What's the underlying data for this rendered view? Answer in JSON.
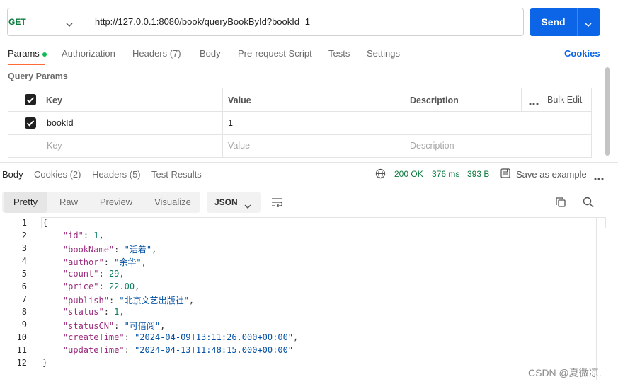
{
  "request": {
    "method": "GET",
    "url": "http://127.0.0.1:8080/book/queryBookById?bookId=1",
    "send_label": "Send",
    "method_color": "#0b7a3e",
    "send_color": "#0b65e6"
  },
  "request_tabs": [
    {
      "label": "Params",
      "active": true,
      "indicator": "green-dot"
    },
    {
      "label": "Authorization"
    },
    {
      "label": "Headers (7)"
    },
    {
      "label": "Body"
    },
    {
      "label": "Pre-request Script"
    },
    {
      "label": "Tests"
    },
    {
      "label": "Settings"
    }
  ],
  "cookies_link": "Cookies",
  "query_params": {
    "title": "Query Params",
    "headers": {
      "key": "Key",
      "value": "Value",
      "description": "Description",
      "bulk_edit": "Bulk Edit"
    },
    "rows": [
      {
        "checked": true,
        "key": "bookId",
        "value": "1",
        "description": ""
      }
    ],
    "placeholder": {
      "key": "Key",
      "value": "Value",
      "description": "Description"
    }
  },
  "response_tabs": [
    {
      "label": "Body",
      "active": true
    },
    {
      "label": "Cookies (2)"
    },
    {
      "label": "Headers (5)"
    },
    {
      "label": "Test Results"
    }
  ],
  "response_status": {
    "status": "200 OK",
    "time": "376 ms",
    "size": "393 B",
    "save_label": "Save as example"
  },
  "view_tabs": [
    {
      "label": "Pretty",
      "active": true
    },
    {
      "label": "Raw"
    },
    {
      "label": "Preview"
    },
    {
      "label": "Visualize"
    }
  ],
  "format_select": "JSON",
  "code_lines": [
    {
      "num": "1",
      "text": "{"
    },
    {
      "num": "2",
      "key": "\"id\"",
      "val": "1",
      "type": "n",
      "comma": true
    },
    {
      "num": "3",
      "key": "\"bookName\"",
      "val": "\"活着\"",
      "type": "s",
      "comma": true
    },
    {
      "num": "4",
      "key": "\"author\"",
      "val": "\"余华\"",
      "type": "s",
      "comma": true
    },
    {
      "num": "5",
      "key": "\"count\"",
      "val": "29",
      "type": "n",
      "comma": true
    },
    {
      "num": "6",
      "key": "\"price\"",
      "val": "22.00",
      "type": "n",
      "comma": true
    },
    {
      "num": "7",
      "key": "\"publish\"",
      "val": "\"北京文艺出版社\"",
      "type": "s",
      "comma": true
    },
    {
      "num": "8",
      "key": "\"status\"",
      "val": "1",
      "type": "n",
      "comma": true
    },
    {
      "num": "9",
      "key": "\"statusCN\"",
      "val": "\"可借阅\"",
      "type": "s",
      "comma": true
    },
    {
      "num": "10",
      "key": "\"createTime\"",
      "val": "\"2024-04-09T13:11:26.000+00:00\"",
      "type": "s",
      "comma": true
    },
    {
      "num": "11",
      "key": "\"updateTime\"",
      "val": "\"2024-04-13T11:48:15.000+00:00\"",
      "type": "s",
      "comma": false
    },
    {
      "num": "12",
      "text": "}"
    }
  ],
  "watermark": "CSDN @夏微凉.",
  "icons": [
    "chevron-down-icon",
    "globe-icon",
    "save-icon",
    "more-icon",
    "wrap-icon",
    "copy-icon",
    "search-icon",
    "checkbox-icon"
  ]
}
